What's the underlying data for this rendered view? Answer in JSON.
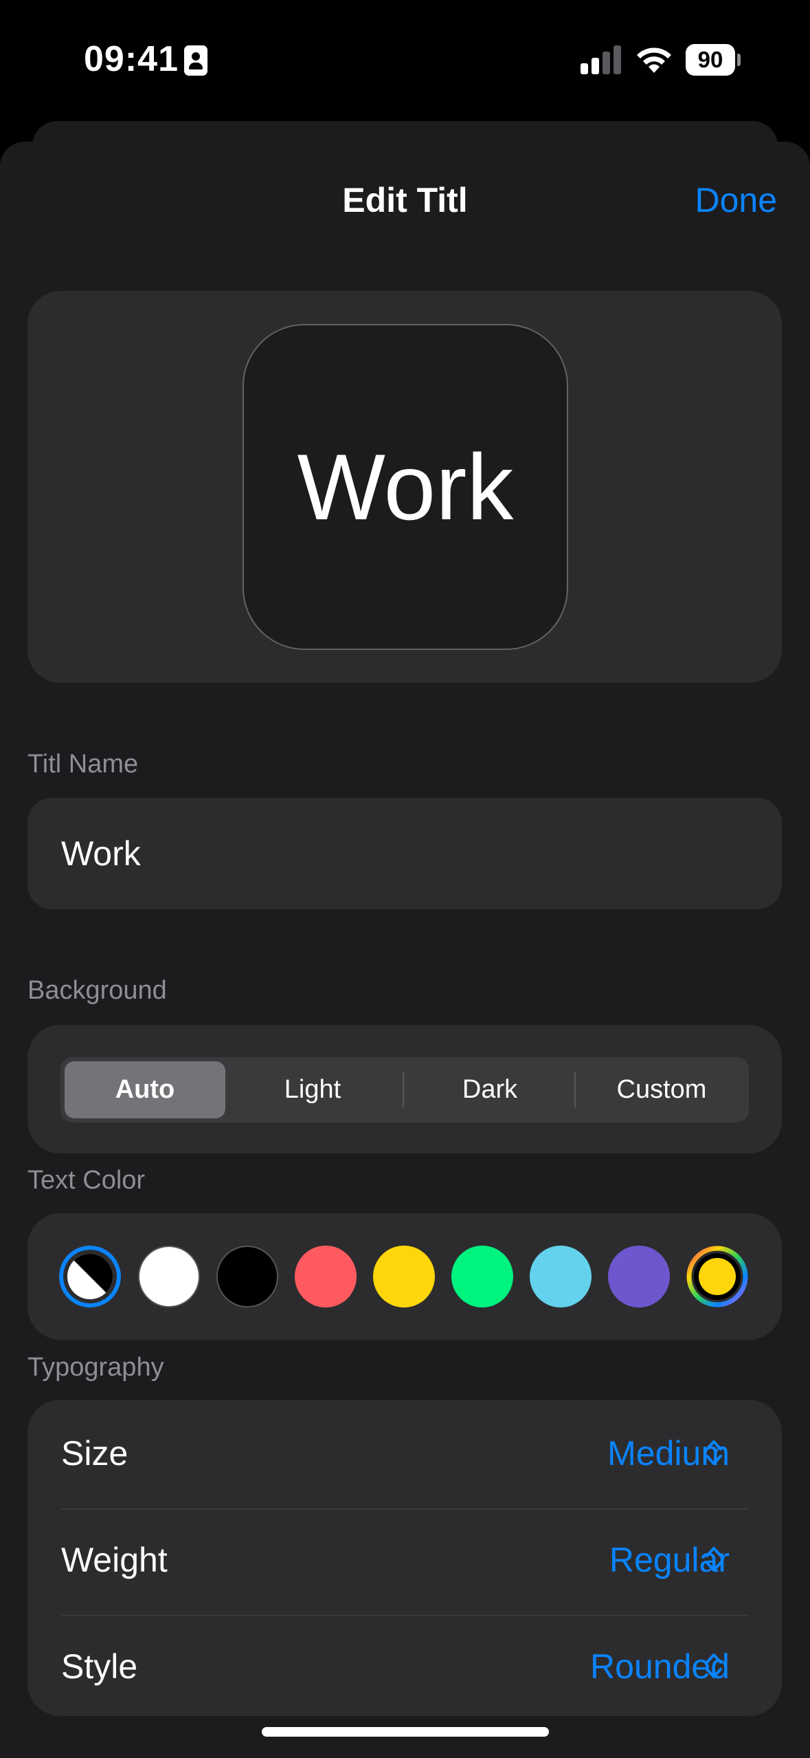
{
  "status_bar": {
    "time": "09:41",
    "battery": "90"
  },
  "header": {
    "title": "Edit Titl",
    "done_label": "Done"
  },
  "preview": {
    "text": "Work"
  },
  "name_section": {
    "label": "Titl Name",
    "value": "Work"
  },
  "background_section": {
    "label": "Background",
    "options": [
      "Auto",
      "Light",
      "Dark",
      "Custom"
    ],
    "selected": "Auto"
  },
  "text_color_section": {
    "label": "Text Color",
    "swatches": [
      {
        "name": "auto",
        "color": "split-black-white",
        "selected": true
      },
      {
        "name": "white",
        "color": "#ffffff"
      },
      {
        "name": "black",
        "color": "#000000"
      },
      {
        "name": "red",
        "color": "#ff5a5f"
      },
      {
        "name": "yellow",
        "color": "#ffd60a"
      },
      {
        "name": "green",
        "color": "#00f27f"
      },
      {
        "name": "light-blue",
        "color": "#64d2ec"
      },
      {
        "name": "purple",
        "color": "#6e56cf"
      },
      {
        "name": "custom",
        "color": "rainbow-ring-yellow"
      }
    ]
  },
  "typography_section": {
    "label": "Typography",
    "rows": [
      {
        "label": "Size",
        "value": "Medium"
      },
      {
        "label": "Weight",
        "value": "Regular"
      },
      {
        "label": "Style",
        "value": "Rounded"
      }
    ]
  },
  "colors": {
    "accent": "#0a84ff",
    "sheet": "#1c1c1e",
    "card": "#2c2c2e"
  }
}
